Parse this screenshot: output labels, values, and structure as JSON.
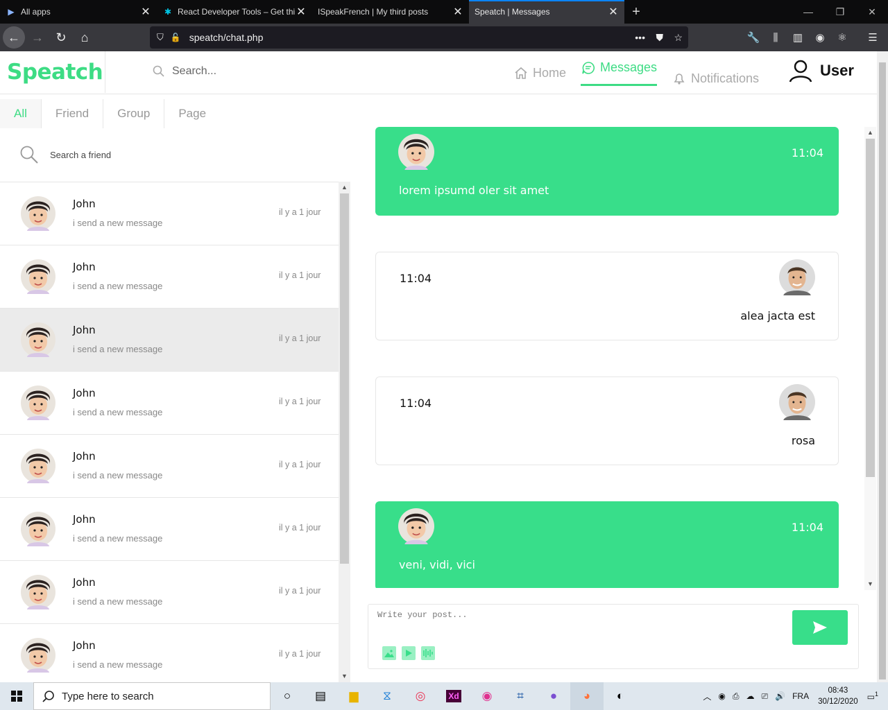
{
  "browser": {
    "tabs": [
      {
        "label": "All apps"
      },
      {
        "label": "React Developer Tools – Get thi"
      },
      {
        "label": "ISpeakFrench | My third posts"
      },
      {
        "label": "Speatch | Messages"
      }
    ],
    "url": "speatch/chat.php"
  },
  "header": {
    "logo": "Speatch",
    "search_placeholder": "Search...",
    "nav": {
      "home": "Home",
      "messages": "Messages",
      "notifications": "Notifications"
    },
    "user": "User"
  },
  "left": {
    "filters": [
      "All",
      "Friend",
      "Group",
      "Page"
    ],
    "search_placeholder": "Search a friend",
    "conversations": [
      {
        "name": "John",
        "message": "i send a new message",
        "time": "il y a 1 jour"
      },
      {
        "name": "John",
        "message": "i send a new message",
        "time": "il y a 1 jour"
      },
      {
        "name": "John",
        "message": "i send a new message",
        "time": "il y a 1 jour"
      },
      {
        "name": "John",
        "message": "i send a new message",
        "time": "il y a 1 jour"
      },
      {
        "name": "John",
        "message": "i send a new message",
        "time": "il y a 1 jour"
      },
      {
        "name": "John",
        "message": "i send a new message",
        "time": "il y a 1 jour"
      },
      {
        "name": "John",
        "message": "i send a new message",
        "time": "il y a 1 jour"
      },
      {
        "name": "John",
        "message": "i send a new message",
        "time": "il y a 1 jour"
      }
    ]
  },
  "chat": {
    "messages": [
      {
        "from": "me",
        "time": "11:04",
        "text": "lorem ipsumd oler sit amet"
      },
      {
        "from": "them",
        "time": "11:04",
        "text": "alea jacta est"
      },
      {
        "from": "them",
        "time": "11:04",
        "text": "rosa"
      },
      {
        "from": "me",
        "time": "11:04",
        "text": "veni, vidi, vici"
      }
    ],
    "compose_placeholder": "Write your post..."
  },
  "taskbar": {
    "search_placeholder": "Type here to search",
    "language": "FRA",
    "time": "08:43",
    "date": "30/12/2020",
    "notification_count": "1"
  },
  "colors": {
    "accent": "#38de8a"
  }
}
